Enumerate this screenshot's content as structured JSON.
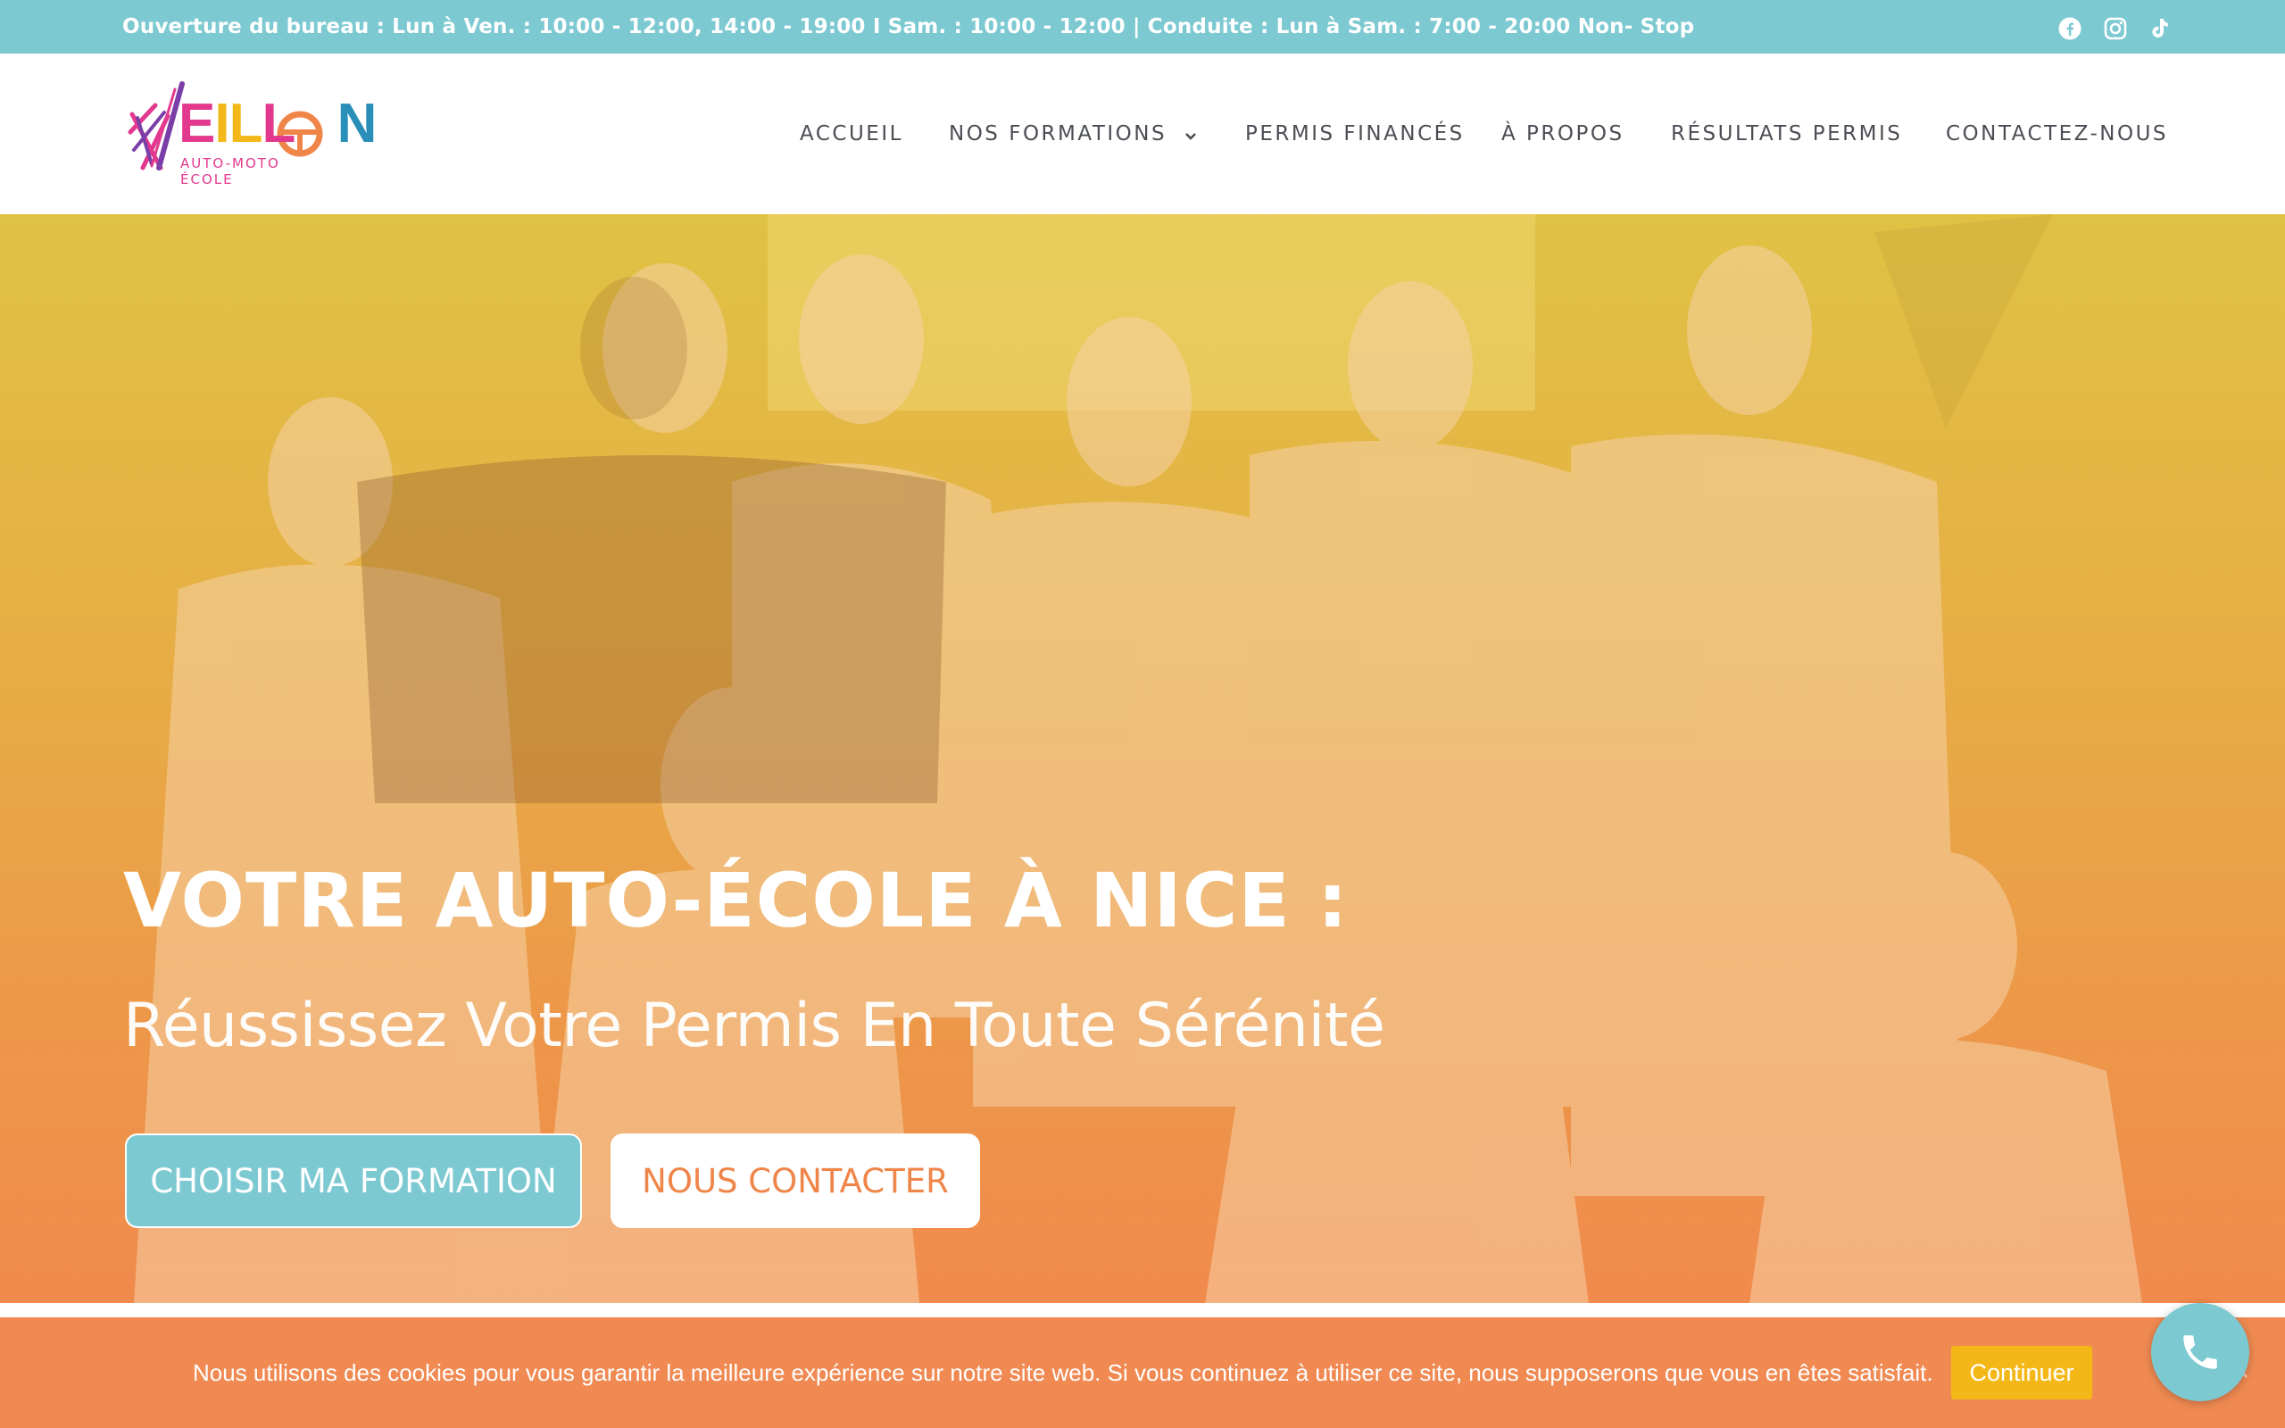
{
  "topbar": {
    "hours_text": "Ouverture du bureau : Lun à Ven. : 10:00 - 12:00, 14:00 - 19:00 I Sam. : 10:00 - 12:00  |  Conduite : Lun à Sam. : 7:00 - 20:00 Non- Stop",
    "social_icons": [
      "facebook-icon",
      "instagram-icon",
      "tiktok-icon"
    ]
  },
  "logo": {
    "wordmark": "VEILLON",
    "tagline": "AUTO-MOTO ÉCOLE"
  },
  "nav": {
    "items": [
      {
        "label": "ACCUEIL"
      },
      {
        "label": "NOS FORMATIONS"
      },
      {
        "label": "PERMIS FINANCÉS"
      },
      {
        "label": "À PROPOS"
      },
      {
        "label": "RÉSULTATS PERMIS"
      },
      {
        "label": "CONTACTEZ-NOUS"
      }
    ]
  },
  "hero": {
    "title": "VOTRE AUTO-ÉCOLE À NICE :",
    "subtitle": "Réussissez Votre Permis En Toute Sérénité",
    "primary_button": "CHOISIR MA FORMATION",
    "secondary_button": "NOUS CONTACTER"
  },
  "cookie": {
    "message": "Nous utilisons des cookies pour vous garantir la meilleure expérience sur notre site web. Si vous continuez à utiliser ce site, nous supposerons que vous en êtes satisfait.",
    "button": "Continuer"
  },
  "colors": {
    "accent_teal": "#7dc9d2",
    "accent_orange": "#f08549",
    "cookie_button": "#f3b818",
    "nav_text": "#4c4e55"
  }
}
